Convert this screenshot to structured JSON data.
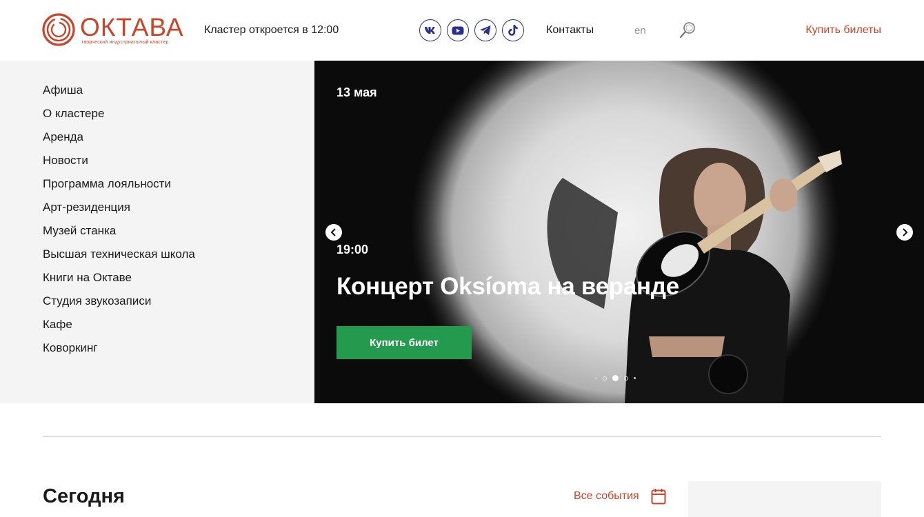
{
  "header": {
    "logo_word": "ОКТАВА",
    "logo_tagline": "творческий индустриальный кластер",
    "hours": "Кластер откроется в 12:00",
    "socials": [
      {
        "name": "vk",
        "icon": "vk-icon"
      },
      {
        "name": "youtube",
        "icon": "youtube-icon"
      },
      {
        "name": "telegram",
        "icon": "telegram-icon"
      },
      {
        "name": "tiktok",
        "icon": "tiktok-icon"
      }
    ],
    "contacts": "Контакты",
    "lang": "en",
    "buy_tickets": "Купить билеты"
  },
  "menu": {
    "items": [
      "Афиша",
      "О кластере",
      "Аренда",
      "Новости",
      "Программа лояльности",
      "Арт-резиденция",
      "Музей станка",
      "Высшая техническая школа",
      "Книги на Октаве",
      "Студия звукозаписи",
      "Кафе",
      "Коворкинг"
    ]
  },
  "hero": {
    "date": "13 мая",
    "time": "19:00",
    "title": "Концерт Oksíoma на веранде",
    "button": "Купить билет",
    "slide_count": 5,
    "active_slide": 3
  },
  "today": {
    "title": "Сегодня",
    "all_events": "Все события"
  },
  "colors": {
    "brand": "#c8452a",
    "social": "#2b2f8c",
    "cta_green": "#249a4f",
    "sidebar_bg": "#f4f4f4"
  }
}
